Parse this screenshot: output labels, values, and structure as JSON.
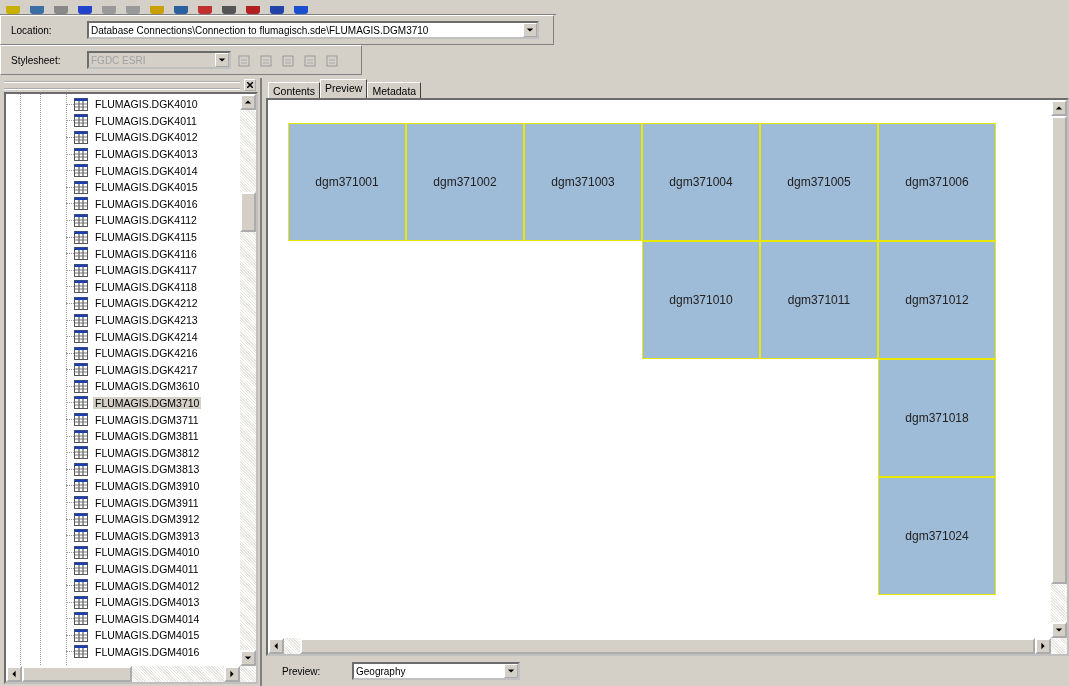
{
  "location_bar": {
    "label": "Location:",
    "value": "Database Connections\\Connection to flumagisch.sde\\FLUMAGIS.DGM3710"
  },
  "stylesheet_bar": {
    "label": "Stylesheet:",
    "value": "FGDC ESRI",
    "disabled": true
  },
  "catalog_tree": {
    "items": [
      {
        "label": "FLUMAGIS.DGK4010",
        "selected": false
      },
      {
        "label": "FLUMAGIS.DGK4011",
        "selected": false
      },
      {
        "label": "FLUMAGIS.DGK4012",
        "selected": false
      },
      {
        "label": "FLUMAGIS.DGK4013",
        "selected": false
      },
      {
        "label": "FLUMAGIS.DGK4014",
        "selected": false
      },
      {
        "label": "FLUMAGIS.DGK4015",
        "selected": false
      },
      {
        "label": "FLUMAGIS.DGK4016",
        "selected": false
      },
      {
        "label": "FLUMAGIS.DGK4112",
        "selected": false
      },
      {
        "label": "FLUMAGIS.DGK4115",
        "selected": false
      },
      {
        "label": "FLUMAGIS.DGK4116",
        "selected": false
      },
      {
        "label": "FLUMAGIS.DGK4117",
        "selected": false
      },
      {
        "label": "FLUMAGIS.DGK4118",
        "selected": false
      },
      {
        "label": "FLUMAGIS.DGK4212",
        "selected": false
      },
      {
        "label": "FLUMAGIS.DGK4213",
        "selected": false
      },
      {
        "label": "FLUMAGIS.DGK4214",
        "selected": false
      },
      {
        "label": "FLUMAGIS.DGK4216",
        "selected": false
      },
      {
        "label": "FLUMAGIS.DGK4217",
        "selected": false
      },
      {
        "label": "FLUMAGIS.DGM3610",
        "selected": false
      },
      {
        "label": "FLUMAGIS.DGM3710",
        "selected": true
      },
      {
        "label": "FLUMAGIS.DGM3711",
        "selected": false
      },
      {
        "label": "FLUMAGIS.DGM3811",
        "selected": false
      },
      {
        "label": "FLUMAGIS.DGM3812",
        "selected": false
      },
      {
        "label": "FLUMAGIS.DGM3813",
        "selected": false
      },
      {
        "label": "FLUMAGIS.DGM3910",
        "selected": false
      },
      {
        "label": "FLUMAGIS.DGM3911",
        "selected": false
      },
      {
        "label": "FLUMAGIS.DGM3912",
        "selected": false
      },
      {
        "label": "FLUMAGIS.DGM3913",
        "selected": false
      },
      {
        "label": "FLUMAGIS.DGM4010",
        "selected": false
      },
      {
        "label": "FLUMAGIS.DGM4011",
        "selected": false
      },
      {
        "label": "FLUMAGIS.DGM4012",
        "selected": false
      },
      {
        "label": "FLUMAGIS.DGM4013",
        "selected": false
      },
      {
        "label": "FLUMAGIS.DGM4014",
        "selected": false
      },
      {
        "label": "FLUMAGIS.DGM4015",
        "selected": false
      },
      {
        "label": "FLUMAGIS.DGM4016",
        "selected": false
      }
    ]
  },
  "tabs": [
    {
      "label": "Contents",
      "selected": false
    },
    {
      "label": "Preview",
      "selected": true
    },
    {
      "label": "Metadata",
      "selected": false
    }
  ],
  "preview_grid": {
    "rows": [
      {
        "cells": [
          {
            "kind": "tile",
            "label": "dgm371001"
          },
          {
            "kind": "tile",
            "label": "dgm371002"
          },
          {
            "kind": "tile",
            "label": "dgm371003"
          },
          {
            "kind": "tile",
            "label": "dgm371004"
          },
          {
            "kind": "tile",
            "label": "dgm371005"
          },
          {
            "kind": "tile",
            "label": "dgm371006"
          }
        ]
      },
      {
        "cells": [
          {
            "kind": "empty"
          },
          {
            "kind": "empty"
          },
          {
            "kind": "empty"
          },
          {
            "kind": "tile",
            "label": "dgm371010"
          },
          {
            "kind": "tile",
            "label": "dgm371011"
          },
          {
            "kind": "tile",
            "label": "dgm371012"
          }
        ]
      },
      {
        "cells": [
          {
            "kind": "empty"
          },
          {
            "kind": "empty"
          },
          {
            "kind": "empty"
          },
          {
            "kind": "empty"
          },
          {
            "kind": "empty"
          },
          {
            "kind": "tile",
            "label": "dgm371018"
          }
        ]
      },
      {
        "cells": [
          {
            "kind": "empty"
          },
          {
            "kind": "empty"
          },
          {
            "kind": "empty"
          },
          {
            "kind": "empty"
          },
          {
            "kind": "empty"
          },
          {
            "kind": "tile",
            "label": "dgm371024"
          }
        ]
      }
    ]
  },
  "preview_bar": {
    "label": "Preview:",
    "value": "Geography"
  }
}
